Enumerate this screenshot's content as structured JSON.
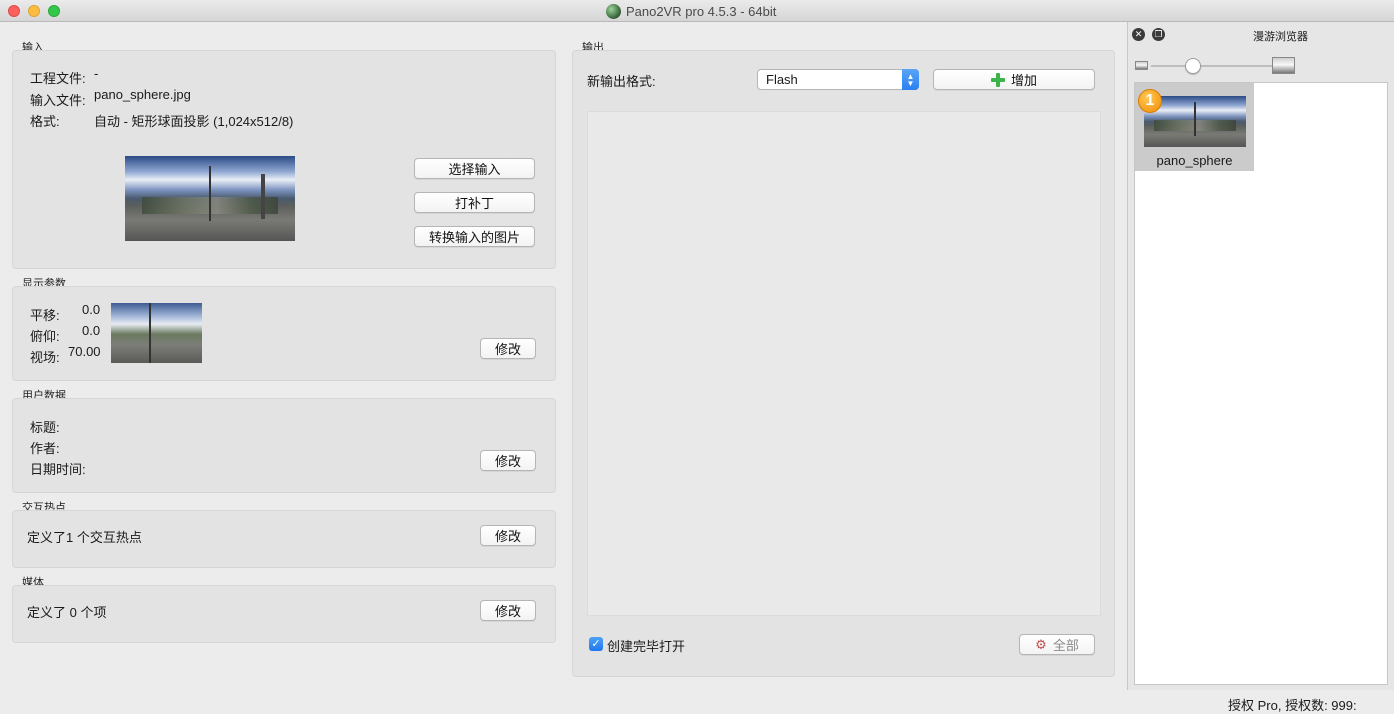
{
  "window": {
    "title": "Pano2VR pro 4.5.3 - 64bit"
  },
  "input": {
    "section_label": "输入",
    "project_file_label": "工程文件:",
    "project_file_value": "-",
    "input_file_label": "输入文件:",
    "input_file_value": "pano_sphere.jpg",
    "format_label": "格式:",
    "format_value": "自动 - 矩形球面投影 (1,024x512/8)",
    "select_input_button": "选择输入",
    "patch_button": "打补丁",
    "convert_button": "转换输入的图片"
  },
  "display": {
    "section_label": "显示参数",
    "pan_label": "平移:",
    "pan_value": "0.0",
    "tilt_label": "俯仰:",
    "tilt_value": "0.0",
    "fov_label": "视场:",
    "fov_value": "70.00",
    "modify_button": "修改"
  },
  "user_data": {
    "section_label": "用户数据",
    "title_label": "标题:",
    "author_label": "作者:",
    "datetime_label": "日期时间:",
    "modify_button": "修改"
  },
  "hotspots": {
    "section_label": "交互热点",
    "summary": "定义了1 个交互热点",
    "modify_button": "修改"
  },
  "media": {
    "section_label": "媒体",
    "summary": "定义了 0 个项",
    "modify_button": "修改"
  },
  "output": {
    "section_label": "输出",
    "new_format_label": "新输出格式:",
    "format_selected": "Flash",
    "add_button": "增加",
    "open_after_label": "创建完毕打开",
    "open_after_checked": true,
    "all_button": "全部"
  },
  "tour_browser": {
    "title": "漫游浏览器",
    "items": [
      {
        "badge": "1",
        "label": "pano_sphere"
      }
    ]
  },
  "status": {
    "license": "授权 Pro, 授权数: 999:"
  },
  "icons": {
    "close": "close-icon",
    "float": "float-window-icon",
    "add": "plus-icon",
    "all": "gears-icon"
  }
}
